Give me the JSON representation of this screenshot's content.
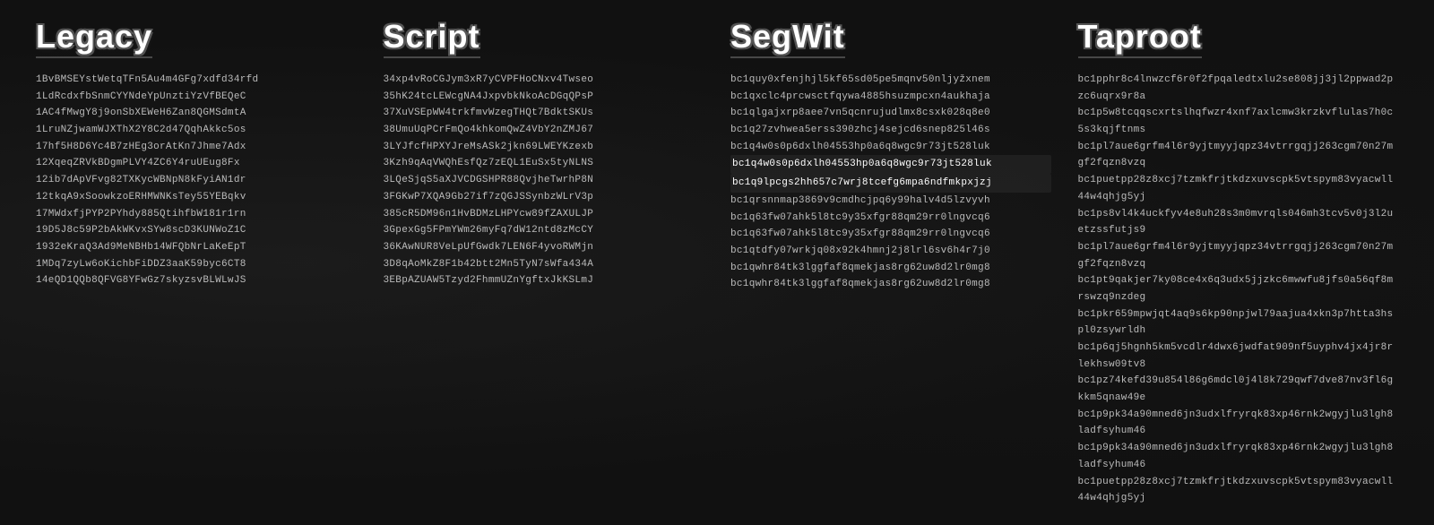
{
  "columns": [
    {
      "id": "legacy",
      "title": "Legacy",
      "addresses": [
        "1BvBMSEYstWetqTFn5Au4m4GFg7xdfd34rfd",
        "1LdRcdxfbSnmCYYNdeYpUnztiYzVfBEQeC",
        "1AC4fMwgY8j9onSbXEWeH6Zan8QGMSdmtA",
        "1LruNZjwamWJXThX2Y8C2d47QqhAkkc5os",
        "17hf5H8D6Yc4B7zHEg3orAtKn7Jhme7Adx",
        "12XqeqZRVkBDgmPLVY4ZC6Y4ruUEug8Fx",
        "12ib7dApVFvg82TXKycWBNpN8kFyiAN1dr",
        "12tkqA9xSoowkzoERHMWNKsTey55YEBqkv",
        "17MWdxfjPYP2PYhdy885QtihfbW181r1rn",
        "19D5J8c59P2bAkWKvxSYw8scD3KUNWoZ1C",
        "1932eKraQ3Ad9MeNBHb14WFQbNrLaKeEpT",
        "1MDq7zyLw6oKichbFiDDZ3aaK59byc6CT8",
        "14eQD1QQb8QFVG8YFwGz7skyzsvBLWLwJS"
      ]
    },
    {
      "id": "script",
      "title": "Script",
      "addresses": [
        "34xp4vRoCGJym3xR7yCVPFHoCNxv4Twseo",
        "35hK24tcLEWcgNA4JxpvbkNkoAcDGqQPsP",
        "37XuVSEpWW4trkfmvWzegTHQt7BdktSKUs",
        "38UmuUqPCrFmQo4khkomQwZ4VbY2nZMJ67",
        "3LYJfcfHPXYJreMsASk2jkn69LWEYKzexb",
        "3Kzh9qAqVWQhEsfQz7zEQL1EuSx5tyNLNS",
        "3LQeSjqS5aXJVCDGSHPR88QvjheTwrhP8N",
        "3FGKwP7XQA9Gb27if7zQGJSSynbzWLrV3p",
        "385cR5DM96n1HvBDMzLHPYcw89fZAXULJP",
        "3GpexGg5FPmYWm26myFq7dW12ntd8zMcCY",
        "36KAwNUR8VeLpUfGwdk7LEN6F4yvoRWMjn",
        "3D8qAoMkZ8F1b42btt2Mn5TyN7sWfa434A",
        "3EBpAZUAW5Tzyd2FhmmUZnYgftxJkKSLmJ"
      ]
    },
    {
      "id": "segwit",
      "title": "SegWit",
      "addresses": [
        "bc1quy0xfenjhjl5kf65sd05pe5mqnv50nljyžxnem",
        "bc1qxclc4prcwsctfqywa4885hsuzmpcxn4aukhaja",
        "bc1qlgajxrp8aee7vn5qcnrujudlmx8csxk028q8e0",
        "bc1q27zvhwea5erss390zhcj4sejcd6snep825l46s",
        "bc1q4w0s0p6dxlh04553hp0a6q8wgc9r73jt528luk",
        "bc1q4w0s0p6dxlh04553hp0a6q8wgc9r73jt528luk",
        "bc1q9lpcgs2hh657c7wrj8tcefg6mpa6ndfmkpxjzj",
        "bc1qrsnnmap3869v9cmdhcjpq6y99halv4d5lzvyvh",
        "bc1q63fw07ahk5l8tc9y35xfgr88qm29rr0lngvcq6",
        "bc1q63fw07ahk5l8tc9y35xfgr88qm29rr0lngvcq6",
        "bc1qtdfy07wrkjq08x92k4hmnj2j8lrl6sv6h4r7j0",
        "bc1qwhr84tk3lggfaf8qmekjas8rg62uw8d2lr0mg8",
        "bc1qwhr84tk3lggfaf8qmekjas8rg62uw8d2lr0mg8"
      ],
      "highlights": [
        5,
        6
      ]
    },
    {
      "id": "taproot",
      "title": "Taproot",
      "addresses": [
        "bc1pphr8c4lnwzcf6r0f2fpqaledtxlu2se808jj3jl2ppwad2pzc6uqrx9r8a",
        "bc1p5w8tcqqscxrtslhqfwzr4xnf7axlcmw3krzkvflulas7h0c5s3kqjftnms",
        "bc1pl7aue6grfm4l6r9yjtmyyjqpz34vtrrgqjj263cgm70n27mgf2fqzn8vzq",
        "bc1puetpp28z8xcj7tzmkfrjtkdzxuvscpk5vtspym83vyacwll44w4qhjg5yj",
        "bc1ps8vl4k4uckfyv4e8uh28s3m0mvrqls046mh3tcv5v0j3l2uetzssfutjs9",
        "bc1pl7aue6grfm4l6r9yjtmyyjqpz34vtrrgqjj263cgm70n27mgf2fqzn8vzq",
        "bc1pt9qakjer7ky08ce4x6q3udx5jjzkc6mwwfu8jfs0a56qf8mrswzq9nzdeg",
        "bc1pkr659mpwjqt4aq9s6kp90npjwl79aajua4xkn3p7htta3hspl0zsywrldh",
        "bc1p6qj5hgnh5km5vcdlr4dwx6jwdfat909nf5uyphv4jx4jr8rlekhsw09tv8",
        "bc1pz74kefd39u854l86g6mdcl0j4l8k729qwf7dve87nv3fl6gkkm5qnaw49e",
        "bc1p9pk34a90mned6jn3udxlfryrqk83xp46rnk2wgyjlu3lgh8ladfsyhum46",
        "bc1p9pk34a90mned6jn3udxlfryrqk83xp46rnk2wgyjlu3lgh8ladfsyhum46",
        "bc1puetpp28z8xcj7tzmkfrjtkdzxuvscpk5vtspym83vyacwll44w4qhjg5yj"
      ]
    }
  ]
}
